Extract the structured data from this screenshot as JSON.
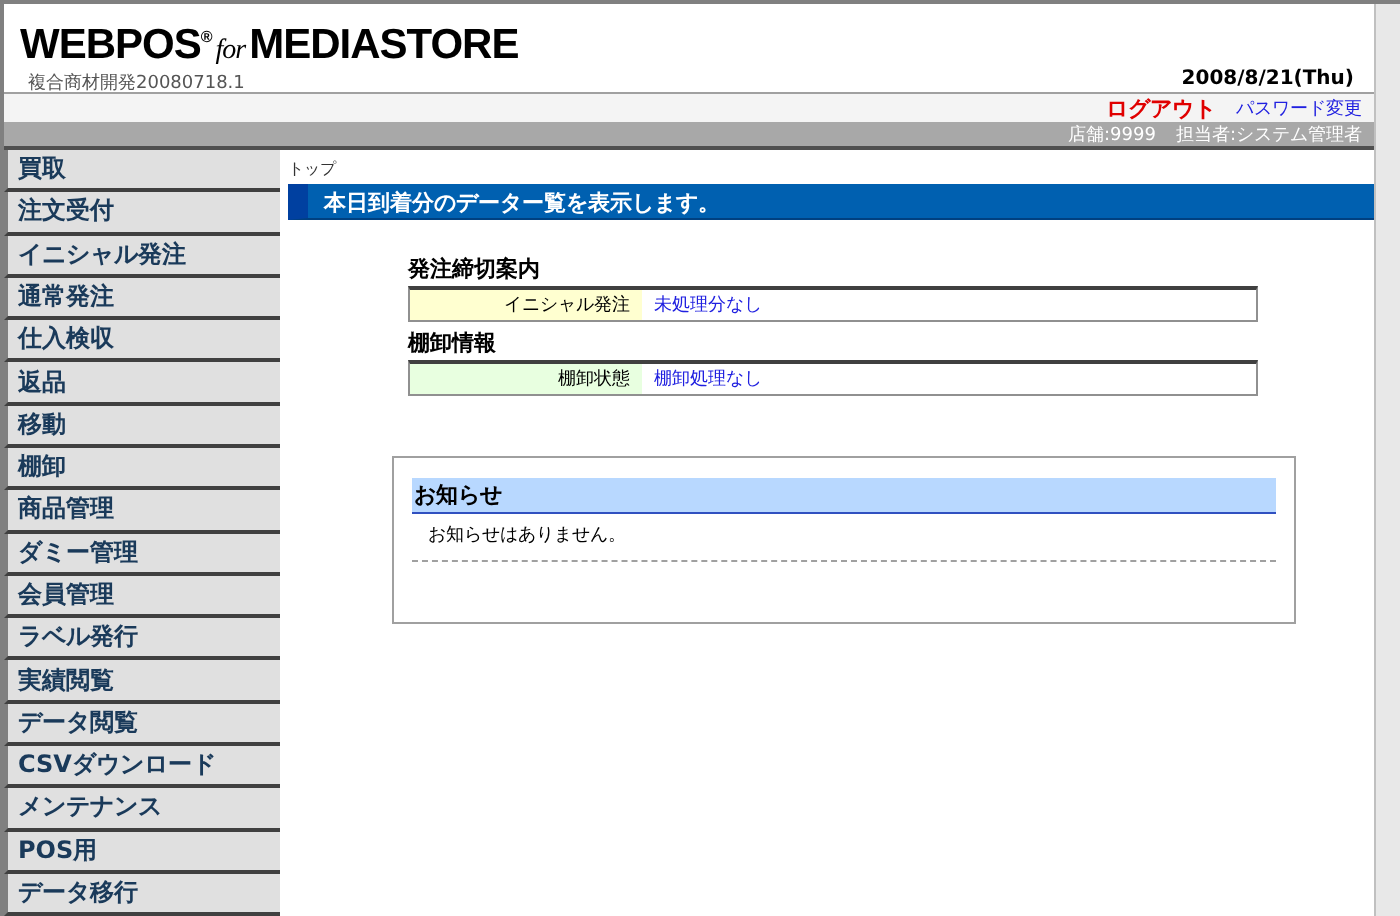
{
  "header": {
    "logo": {
      "product": "WEBPOS$^{®}$",
      "connector": "for",
      "brand": "MEDIASTORE"
    },
    "version": "複合商材開発20080718.1",
    "date": "2008/8/21(Thu)"
  },
  "links": [
    {
      "label": "ログアウト",
      "kind": "logout"
    },
    {
      "label": "パスワード変更",
      "kind": "link"
    }
  ],
  "user_bar": {
    "store": "店舗:9999",
    "staff": "担当者:システム管理者"
  },
  "sidebar": {
    "items": [
      {
        "label": "買取"
      },
      {
        "label": "注文受付"
      },
      {
        "label": "イニシャル発注"
      },
      {
        "label": "通常発注"
      },
      {
        "label": "仕入検収"
      },
      {
        "label": "返品"
      },
      {
        "label": "移動"
      },
      {
        "label": "棚卸"
      },
      {
        "label": "商品管理"
      },
      {
        "label": "ダミー管理"
      },
      {
        "label": "会員管理"
      },
      {
        "label": "ラベル発行"
      },
      {
        "label": "実績閲覧"
      },
      {
        "label": "データ閲覧"
      },
      {
        "label": "CSVダウンロード"
      },
      {
        "label": "メンテナンス"
      },
      {
        "label": "POS用"
      },
      {
        "label": "データ移行"
      }
    ]
  },
  "breadcrumb": "トップ",
  "banner": "本日到着分のデーター覧を表示します。",
  "sections": [
    {
      "title": "発注締切案内",
      "label": "イニシャル発注",
      "value": "未処理分なし",
      "color": "#ffffd0"
    },
    {
      "title": "棚卸情報",
      "label": "棚卸状態",
      "value": "棚卸処理なし",
      "color": "#e8ffe0"
    }
  ],
  "notice": {
    "title": "お知らせ",
    "message": "お知らせはありません。"
  }
}
